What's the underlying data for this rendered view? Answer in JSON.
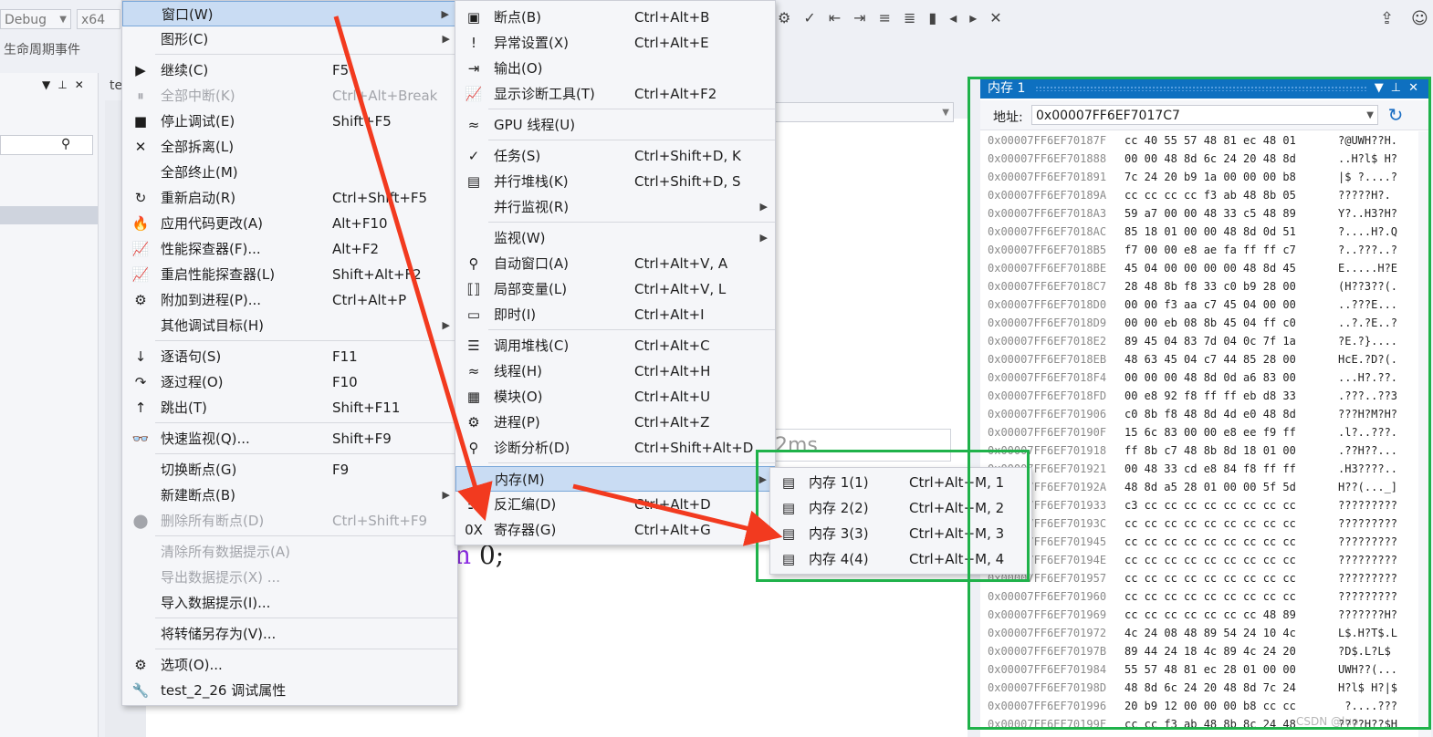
{
  "toolbar": {
    "config": "Debug",
    "platform": "x64",
    "lifecycle": "生命周期事件"
  },
  "debug_menu": {
    "items": [
      {
        "label": "窗口(W)",
        "shortcut": "",
        "icon": "",
        "submenu": true,
        "disabled": false,
        "highlighted": true
      },
      {
        "label": "图形(C)",
        "shortcut": "",
        "icon": "",
        "submenu": true,
        "disabled": false
      },
      {
        "label": "继续(C)",
        "shortcut": "F5",
        "icon": "▶",
        "submenu": false,
        "disabled": false
      },
      {
        "label": "全部中断(K)",
        "shortcut": "Ctrl+Alt+Break",
        "icon": "⏸",
        "submenu": false,
        "disabled": true
      },
      {
        "label": "停止调试(E)",
        "shortcut": "Shift+F5",
        "icon": "■",
        "submenu": false,
        "disabled": false
      },
      {
        "label": "全部拆离(L)",
        "shortcut": "",
        "icon": "✕",
        "submenu": false,
        "disabled": false
      },
      {
        "label": "全部终止(M)",
        "shortcut": "",
        "icon": "",
        "submenu": false,
        "disabled": false
      },
      {
        "label": "重新启动(R)",
        "shortcut": "Ctrl+Shift+F5",
        "icon": "↻",
        "submenu": false,
        "disabled": false
      },
      {
        "label": "应用代码更改(A)",
        "shortcut": "Alt+F10",
        "icon": "🔥",
        "submenu": false,
        "disabled": false
      },
      {
        "label": "性能探查器(F)...",
        "shortcut": "Alt+F2",
        "icon": "📈",
        "submenu": false,
        "disabled": false
      },
      {
        "label": "重启性能探查器(L)",
        "shortcut": "Shift+Alt+F2",
        "icon": "📈",
        "submenu": false,
        "disabled": false
      },
      {
        "label": "附加到进程(P)...",
        "shortcut": "Ctrl+Alt+P",
        "icon": "⚙",
        "submenu": false,
        "disabled": false
      },
      {
        "label": "其他调试目标(H)",
        "shortcut": "",
        "icon": "",
        "submenu": true,
        "disabled": false
      },
      {
        "label": "逐语句(S)",
        "shortcut": "F11",
        "icon": "↓",
        "submenu": false,
        "disabled": false
      },
      {
        "label": "逐过程(O)",
        "shortcut": "F10",
        "icon": "↷",
        "submenu": false,
        "disabled": false
      },
      {
        "label": "跳出(T)",
        "shortcut": "Shift+F11",
        "icon": "↑",
        "submenu": false,
        "disabled": false
      },
      {
        "label": "快速监视(Q)...",
        "shortcut": "Shift+F9",
        "icon": "👓",
        "submenu": false,
        "disabled": false
      },
      {
        "label": "切换断点(G)",
        "shortcut": "F9",
        "icon": "",
        "submenu": false,
        "disabled": false
      },
      {
        "label": "新建断点(B)",
        "shortcut": "",
        "icon": "",
        "submenu": true,
        "disabled": false
      },
      {
        "label": "删除所有断点(D)",
        "shortcut": "Ctrl+Shift+F9",
        "icon": "⬤",
        "submenu": false,
        "disabled": true
      },
      {
        "label": "清除所有数据提示(A)",
        "shortcut": "",
        "icon": "",
        "submenu": false,
        "disabled": true
      },
      {
        "label": "导出数据提示(X) ...",
        "shortcut": "",
        "icon": "",
        "submenu": false,
        "disabled": true
      },
      {
        "label": "导入数据提示(I)...",
        "shortcut": "",
        "icon": "",
        "submenu": false,
        "disabled": false
      },
      {
        "label": "将转储另存为(V)...",
        "shortcut": "",
        "icon": "",
        "submenu": false,
        "disabled": false
      },
      {
        "label": "选项(O)...",
        "shortcut": "",
        "icon": "⚙",
        "submenu": false,
        "disabled": false
      },
      {
        "label": "test_2_26 调试属性",
        "shortcut": "",
        "icon": "🔧",
        "submenu": false,
        "disabled": false
      }
    ]
  },
  "window_menu": {
    "items": [
      {
        "label": "断点(B)",
        "shortcut": "Ctrl+Alt+B",
        "icon": "▣",
        "submenu": false
      },
      {
        "label": "异常设置(X)",
        "shortcut": "Ctrl+Alt+E",
        "icon": "!",
        "submenu": false
      },
      {
        "label": "输出(O)",
        "shortcut": "",
        "icon": "⇥",
        "submenu": false
      },
      {
        "label": "显示诊断工具(T)",
        "shortcut": "Ctrl+Alt+F2",
        "icon": "📈",
        "submenu": false
      },
      {
        "label": "GPU 线程(U)",
        "shortcut": "",
        "icon": "≈",
        "submenu": false
      },
      {
        "label": "任务(S)",
        "shortcut": "Ctrl+Shift+D, K",
        "icon": "✓",
        "submenu": false
      },
      {
        "label": "并行堆栈(K)",
        "shortcut": "Ctrl+Shift+D, S",
        "icon": "▤",
        "submenu": false
      },
      {
        "label": "并行监视(R)",
        "shortcut": "",
        "icon": "",
        "submenu": true
      },
      {
        "label": "监视(W)",
        "shortcut": "",
        "icon": "",
        "submenu": true
      },
      {
        "label": "自动窗口(A)",
        "shortcut": "Ctrl+Alt+V, A",
        "icon": "⚲",
        "submenu": false
      },
      {
        "label": "局部变量(L)",
        "shortcut": "Ctrl+Alt+V, L",
        "icon": "⟦⟧",
        "submenu": false
      },
      {
        "label": "即时(I)",
        "shortcut": "Ctrl+Alt+I",
        "icon": "▭",
        "submenu": false
      },
      {
        "label": "调用堆栈(C)",
        "shortcut": "Ctrl+Alt+C",
        "icon": "☰",
        "submenu": false
      },
      {
        "label": "线程(H)",
        "shortcut": "Ctrl+Alt+H",
        "icon": "≈",
        "submenu": false
      },
      {
        "label": "模块(O)",
        "shortcut": "Ctrl+Alt+U",
        "icon": "▦",
        "submenu": false
      },
      {
        "label": "进程(P)",
        "shortcut": "Ctrl+Alt+Z",
        "icon": "⚙",
        "submenu": false
      },
      {
        "label": "诊断分析(D)",
        "shortcut": "Ctrl+Shift+Alt+D",
        "icon": "⚲",
        "submenu": false
      },
      {
        "label": "内存(M)",
        "shortcut": "",
        "icon": "",
        "submenu": true,
        "highlighted": true
      },
      {
        "label": "反汇编(D)",
        "shortcut": "Ctrl+Alt+D",
        "icon": "☷",
        "submenu": false
      },
      {
        "label": "寄存器(G)",
        "shortcut": "Ctrl+Alt+G",
        "icon": "0X",
        "submenu": false
      }
    ]
  },
  "memory_menu": {
    "items": [
      {
        "label": "内存 1(1)",
        "shortcut": "Ctrl+Alt+M, 1"
      },
      {
        "label": "内存 2(2)",
        "shortcut": "Ctrl+Alt+M, 2"
      },
      {
        "label": "内存 3(3)",
        "shortcut": "Ctrl+Alt+M, 3"
      },
      {
        "label": "内存 4(4)",
        "shortcut": "Ctrl+Alt+M, 4"
      }
    ]
  },
  "editor": {
    "tab": "te",
    "code_kw": "n",
    "code_rest": " 0;",
    "tip": "2ms"
  },
  "memory_window": {
    "title": "内存 1",
    "address_label": "地址:",
    "address_value": "0x00007FF6EF7017C7",
    "rows": [
      {
        "addr": "0x00007FF6EF70187F",
        "bytes": "cc 40 55 57 48 81 ec 48 01",
        "ascii": "?@UWH??H."
      },
      {
        "addr": "0x00007FF6EF701888",
        "bytes": "00 00 48 8d 6c 24 20 48 8d",
        "ascii": "..H?l$ H?"
      },
      {
        "addr": "0x00007FF6EF701891",
        "bytes": "7c 24 20 b9 1a 00 00 00 b8",
        "ascii": "|$ ?....?"
      },
      {
        "addr": "0x00007FF6EF70189A",
        "bytes": "cc cc cc cc f3 ab 48 8b 05",
        "ascii": "?????H?."
      },
      {
        "addr": "0x00007FF6EF7018A3",
        "bytes": "59 a7 00 00 48 33 c5 48 89",
        "ascii": "Y?..H3?H?"
      },
      {
        "addr": "0x00007FF6EF7018AC",
        "bytes": "85 18 01 00 00 48 8d 0d 51",
        "ascii": "?....H?.Q"
      },
      {
        "addr": "0x00007FF6EF7018B5",
        "bytes": "f7 00 00 e8 ae fa ff ff c7",
        "ascii": "?..???..?"
      },
      {
        "addr": "0x00007FF6EF7018BE",
        "bytes": "45 04 00 00 00 00 48 8d 45",
        "ascii": "E.....H?E"
      },
      {
        "addr": "0x00007FF6EF7018C7",
        "bytes": "28 48 8b f8 33 c0 b9 28 00",
        "ascii": "(H??3??(."
      },
      {
        "addr": "0x00007FF6EF7018D0",
        "bytes": "00 00 f3 aa c7 45 04 00 00",
        "ascii": "..???E..."
      },
      {
        "addr": "0x00007FF6EF7018D9",
        "bytes": "00 00 eb 08 8b 45 04 ff c0",
        "ascii": "..?.?E..?"
      },
      {
        "addr": "0x00007FF6EF7018E2",
        "bytes": "89 45 04 83 7d 04 0c 7f 1a",
        "ascii": "?E.?}...."
      },
      {
        "addr": "0x00007FF6EF7018EB",
        "bytes": "48 63 45 04 c7 44 85 28 00",
        "ascii": "HcE.?D?(."
      },
      {
        "addr": "0x00007FF6EF7018F4",
        "bytes": "00 00 00 48 8d 0d a6 83 00",
        "ascii": "...H?.??."
      },
      {
        "addr": "0x00007FF6EF7018FD",
        "bytes": "00 e8 92 f8 ff ff eb d8 33",
        "ascii": ".???..??3"
      },
      {
        "addr": "0x00007FF6EF701906",
        "bytes": "c0 8b f8 48 8d 4d e0 48 8d",
        "ascii": "???H?M?H?"
      },
      {
        "addr": "0x00007FF6EF70190F",
        "bytes": "15 6c 83 00 00 e8 ee f9 ff",
        "ascii": ".l?..???."
      },
      {
        "addr": "0x00007FF6EF701918",
        "bytes": "ff 8b c7 48 8b 8d 18 01 00",
        "ascii": ".??H??..."
      },
      {
        "addr": "0x00007FF6EF701921",
        "bytes": "00 48 33 cd e8 84 f8 ff ff",
        "ascii": ".H3????.."
      },
      {
        "addr": "0x00007FF6EF70192A",
        "bytes": "48 8d a5 28 01 00 00 5f 5d",
        "ascii": "H??(..._]"
      },
      {
        "addr": "0x00007FF6EF701933",
        "bytes": "c3 cc cc cc cc cc cc cc cc",
        "ascii": "?????????"
      },
      {
        "addr": "0x00007FF6EF70193C",
        "bytes": "cc cc cc cc cc cc cc cc cc",
        "ascii": "?????????"
      },
      {
        "addr": "0x00007FF6EF701945",
        "bytes": "cc cc cc cc cc cc cc cc cc",
        "ascii": "?????????"
      },
      {
        "addr": "0x00007FF6EF70194E",
        "bytes": "cc cc cc cc cc cc cc cc cc",
        "ascii": "?????????"
      },
      {
        "addr": "0x00007FF6EF701957",
        "bytes": "cc cc cc cc cc cc cc cc cc",
        "ascii": "?????????"
      },
      {
        "addr": "0x00007FF6EF701960",
        "bytes": "cc cc cc cc cc cc cc cc cc",
        "ascii": "?????????"
      },
      {
        "addr": "0x00007FF6EF701969",
        "bytes": "cc cc cc cc cc cc cc 48 89",
        "ascii": "???????H?"
      },
      {
        "addr": "0x00007FF6EF701972",
        "bytes": "4c 24 08 48 89 54 24 10 4c",
        "ascii": "L$.H?T$.L"
      },
      {
        "addr": "0x00007FF6EF70197B",
        "bytes": "89 44 24 18 4c 89 4c 24 20",
        "ascii": "?D$.L?L$ "
      },
      {
        "addr": "0x00007FF6EF701984",
        "bytes": "55 57 48 81 ec 28 01 00 00",
        "ascii": "UWH??(..."
      },
      {
        "addr": "0x00007FF6EF70198D",
        "bytes": "48 8d 6c 24 20 48 8d 7c 24",
        "ascii": "H?l$ H?|$"
      },
      {
        "addr": "0x00007FF6EF701996",
        "bytes": "20 b9 12 00 00 00 b8 cc cc",
        "ascii": " ?....???"
      },
      {
        "addr": "0x00007FF6EF70199F",
        "bytes": "cc cc f3 ab 48 8b 8c 24 48",
        "ascii": "????H??$H"
      }
    ]
  },
  "watermark": "CSDN @luo"
}
